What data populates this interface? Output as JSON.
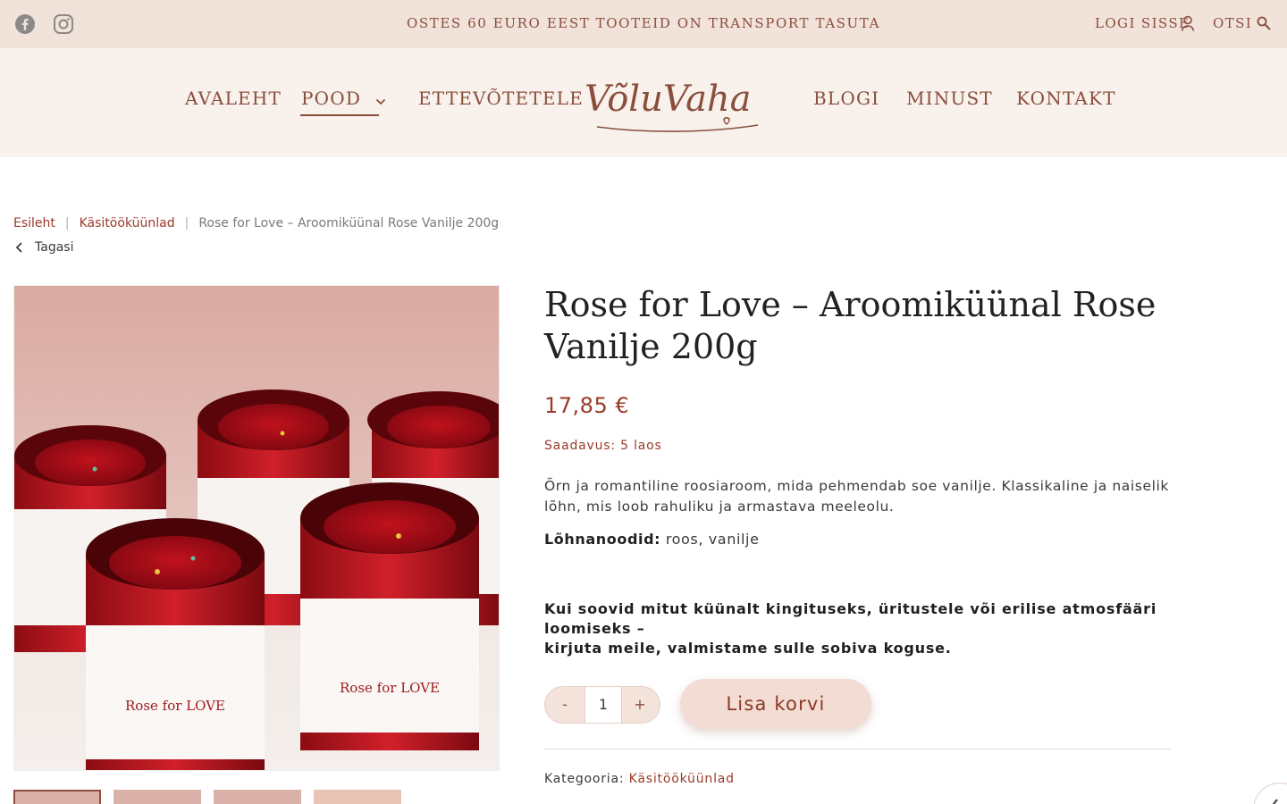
{
  "topbar": {
    "promo": "OSTES 60 EURO EEST TOOTEID ON TRANSPORT TASUTA",
    "login": "LOGI SISSE",
    "search": "OTSI",
    "social": [
      "facebook-icon",
      "instagram-icon"
    ]
  },
  "nav": {
    "items": [
      "AVALEHT",
      "POOD",
      "ETTEVÕTETELE",
      "BLOGI",
      "MINUST",
      "KONTAKT"
    ],
    "active": "POOD",
    "logo_text": "VõluVaha"
  },
  "breadcrumb": {
    "home": "Esileht",
    "category": "Käsitööküünlad",
    "current": "Rose for Love – Aroomiküünal Rose Vanilje 200g",
    "back": "Tagasi"
  },
  "product": {
    "title": "Rose for Love – Aroomiküünal Rose Vanilje 200g",
    "price": "17,85 €",
    "stock": "Saadavus: 5 laos",
    "description": "Õrn ja romantiline roosiaroom, mida pehmendab soe vanilje. Klassikaline ja naiselik lõhn, mis loob rahuliku ja armastava meeleolu.",
    "notes_label": "Lõhnanoodid:",
    "notes_value": "roos, vanilje",
    "cta_line1": "Kui soovid mitut küünalt kingituseks, üritustele või erilise atmosfääri loomiseks –",
    "cta_line2": "kirjuta meile, valmistame sulle sobiva koguse.",
    "qty_minus": "-",
    "qty_value": "1",
    "qty_plus": "+",
    "add_to_cart": "Lisa korvi",
    "category_label": "Kategooria:",
    "category_value": "Käsitööküünlad",
    "label_text": "Rose for LOVE"
  },
  "colors": {
    "accent": "#8a4e3c",
    "price": "#9a3a2a",
    "topbar_bg": "#f1e2da",
    "nav_bg": "#f9f1ec",
    "button_bg": "#f2dcd3"
  }
}
